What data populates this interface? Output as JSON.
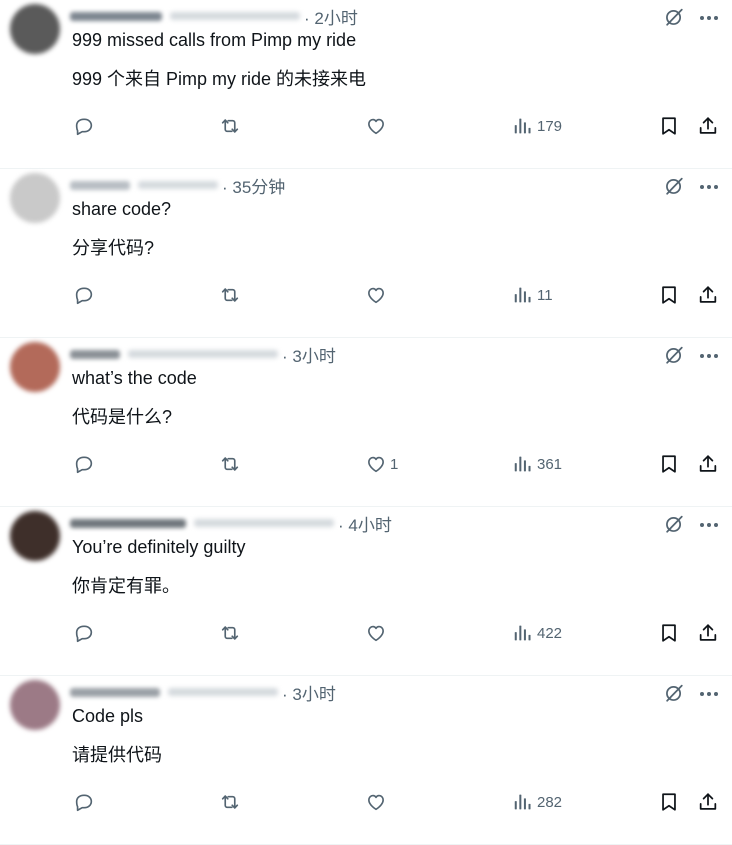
{
  "replies": [
    {
      "time": "2小时",
      "text_en": "999 missed calls from Pimp my ride",
      "text_zh": "999 个来自 Pimp my ride 的未接来电",
      "likes": "",
      "views": "179",
      "avatar_color": "#5a5a5a",
      "name_color": "#7d8690"
    },
    {
      "time": "35分钟",
      "text_en": "share code?",
      "text_zh": "分享代码?",
      "likes": "",
      "views": "11",
      "avatar_color": "#c9c9c9",
      "name_color": "#b8bec4"
    },
    {
      "time": "3小时",
      "text_en": "what’s the code",
      "text_zh": "代码是什么?",
      "likes": "1",
      "views": "361",
      "avatar_color": "#b36a5a",
      "name_color": "#8a9096"
    },
    {
      "time": "4小时",
      "text_en": "You’re definitely guilty",
      "text_zh": "你肯定有罪。",
      "likes": "",
      "views": "422",
      "avatar_color": "#3e2f2a",
      "name_color": "#6f767c"
    },
    {
      "time": "3小时",
      "text_en": "Code pls",
      "text_zh": "请提供代码",
      "likes": "",
      "views": "282",
      "avatar_color": "#9c7a86",
      "name_color": "#9aa0a6"
    }
  ],
  "icons": {
    "reply": "reply-icon",
    "retweet": "retweet-icon",
    "like": "heart-icon",
    "views": "views-icon",
    "bookmark": "bookmark-icon",
    "share": "share-icon",
    "grok": "grok-icon",
    "more": "more-icon"
  },
  "colors": {
    "text": "#0f1419",
    "muted": "#536471",
    "divider": "#eff3f4"
  }
}
